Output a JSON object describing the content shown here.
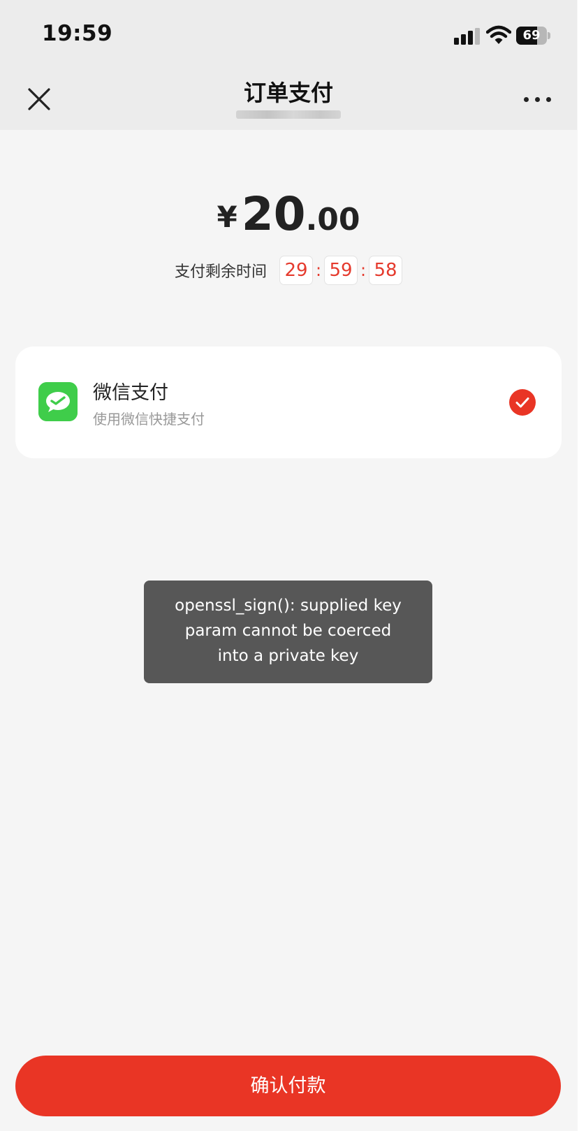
{
  "status_bar": {
    "time": "19:59",
    "battery_level": "69",
    "signal_bars": 3,
    "signal_total_bars": 4,
    "icons": [
      "signal-icon",
      "wifi-icon",
      "battery-icon"
    ]
  },
  "nav": {
    "title": "订单支付",
    "icons": [
      "close-icon",
      "more-icon"
    ]
  },
  "amount": {
    "currency": "¥",
    "integer": "20",
    "decimal": ".00"
  },
  "countdown": {
    "label": "支付剩余时间",
    "hours": "29",
    "minutes": "59",
    "seconds": "58",
    "separator": ":"
  },
  "payment_method": {
    "name": "微信支付",
    "description": "使用微信快捷支付",
    "selected": true,
    "icon": "wechat-icon"
  },
  "toast": {
    "lines": [
      "openssl_sign(): supplied key",
      "param cannot be coerced",
      "into a private key"
    ]
  },
  "confirm_button": {
    "label": "确认付款"
  },
  "colors": {
    "accent_red": "#e93525",
    "countdown_red": "#e53a2d",
    "wechat_green": "#3fcd4a",
    "toast_bg": "#575757",
    "page_bg": "#f5f5f5",
    "header_bg": "#ececec"
  }
}
